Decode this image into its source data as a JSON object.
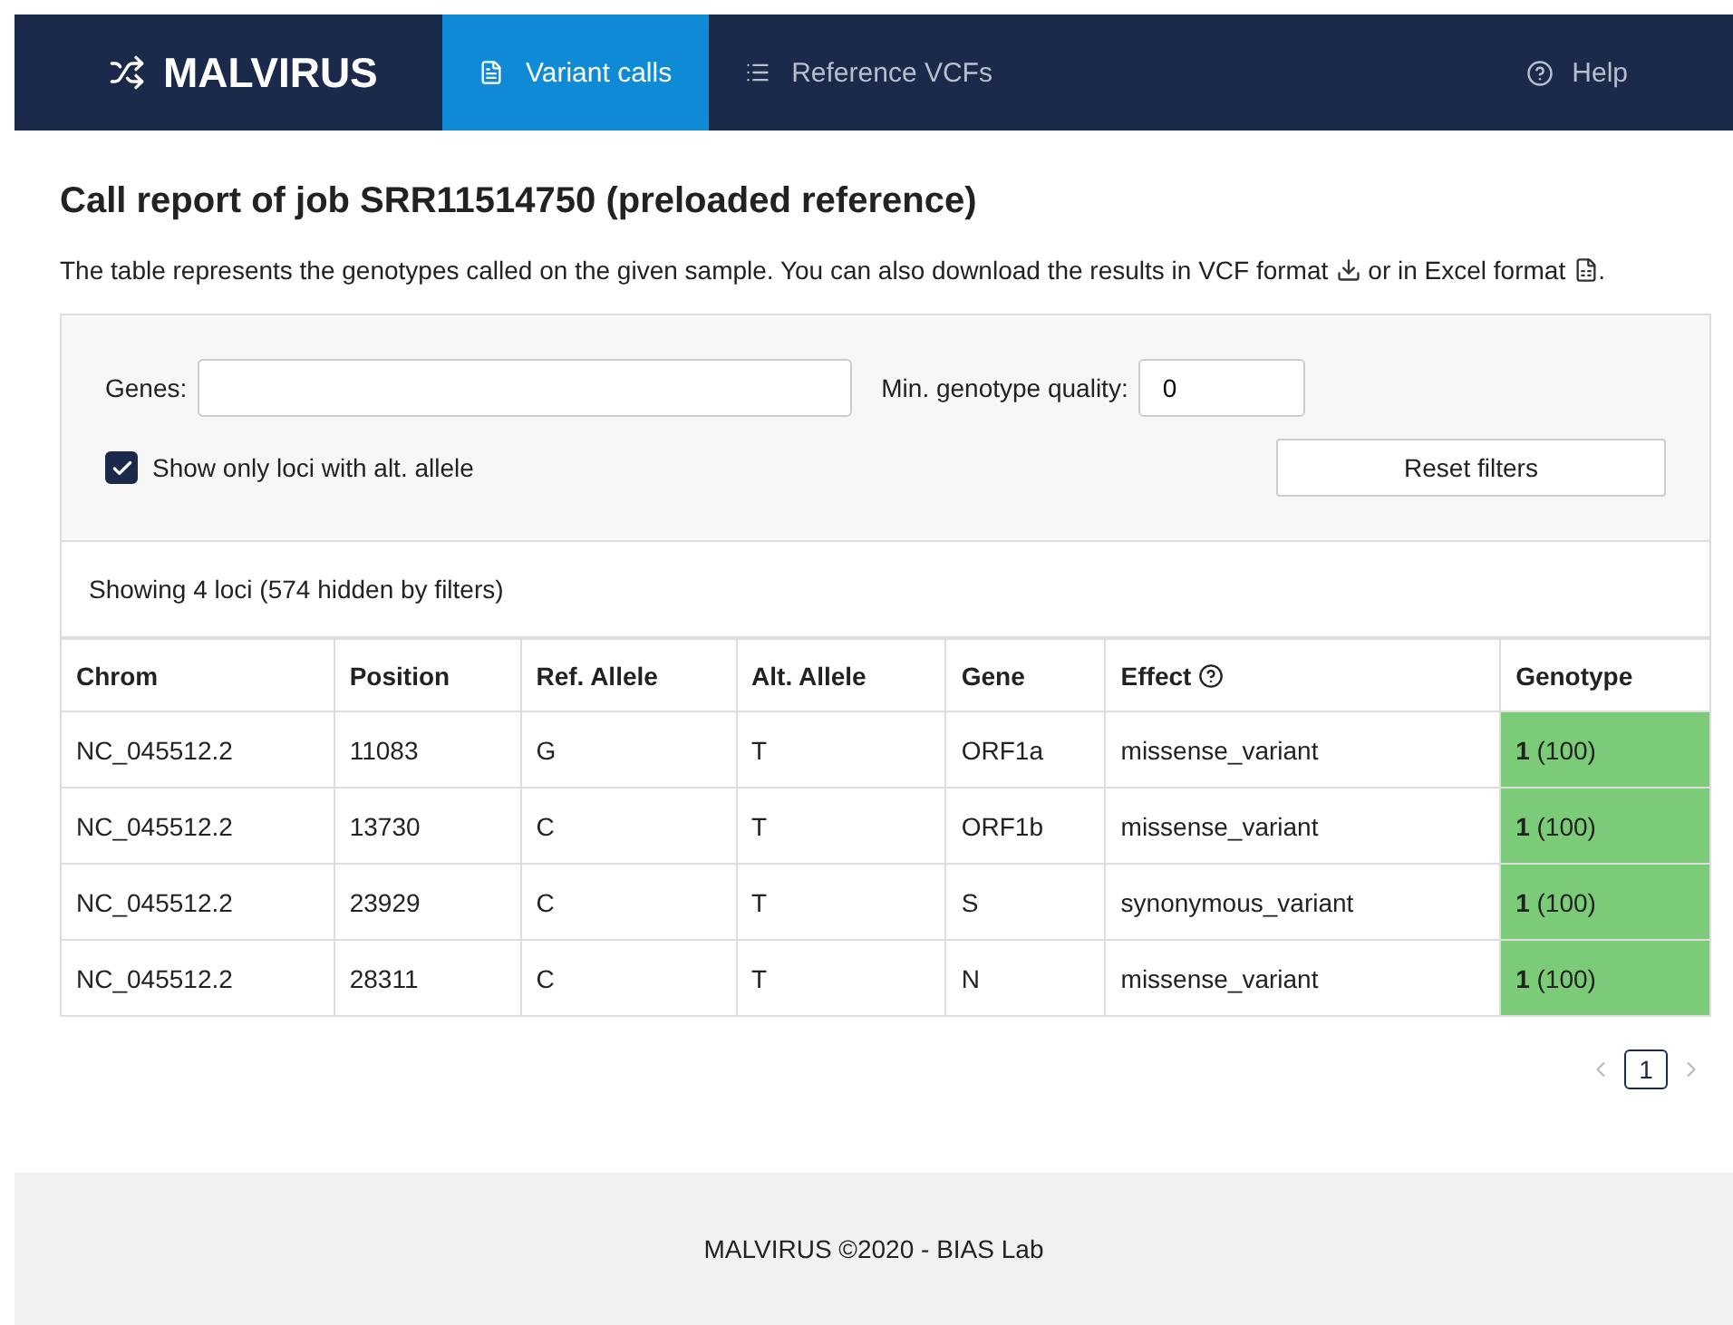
{
  "navbar": {
    "brand": "MALVIRUS",
    "tabs": [
      {
        "label": "Variant calls",
        "kind": "file",
        "selected": true
      },
      {
        "label": "Reference VCFs",
        "kind": "list",
        "selected": false
      }
    ],
    "help": "Help"
  },
  "title": "Call report of job SRR11514750 (preloaded reference)",
  "intro": {
    "text_1": "The table represents the genotypes called on the given sample. You can also download the results in VCF format",
    "text_2": "or in Excel format",
    "text_3": "."
  },
  "filters": {
    "genes_label": "Genes:",
    "quality_label": "Min. genotype quality:",
    "quality_value": "0",
    "alt_only": {
      "label": "Show only loci with alt. allele",
      "checked": true
    },
    "reset": "Reset filters"
  },
  "summary": "Showing 4 loci (574 hidden by filters)",
  "table": {
    "columns": [
      "Chrom",
      "Position",
      "Ref. Allele",
      "Alt. Allele",
      "Gene",
      "Effect",
      "Genotype"
    ],
    "rows": [
      [
        "NC_045512.2",
        "11083",
        "G",
        "T",
        "ORF1a",
        "missense_variant",
        "**1** (100)"
      ],
      [
        "NC_045512.2",
        "13730",
        "C",
        "T",
        "ORF1b",
        "missense_variant",
        "**1** (100)"
      ],
      [
        "NC_045512.2",
        "23929",
        "C",
        "T",
        "S",
        "synonymous_variant",
        "**1** (100)"
      ],
      [
        "NC_045512.2",
        "28311",
        "C",
        "T",
        "N",
        "missense_variant",
        "**1** (100)"
      ]
    ]
  },
  "pagination": {
    "pages": [
      {
        "label": "1",
        "selected": true
      }
    ]
  },
  "footer": "MALVIRUS ©2020 - BIAS Lab"
}
